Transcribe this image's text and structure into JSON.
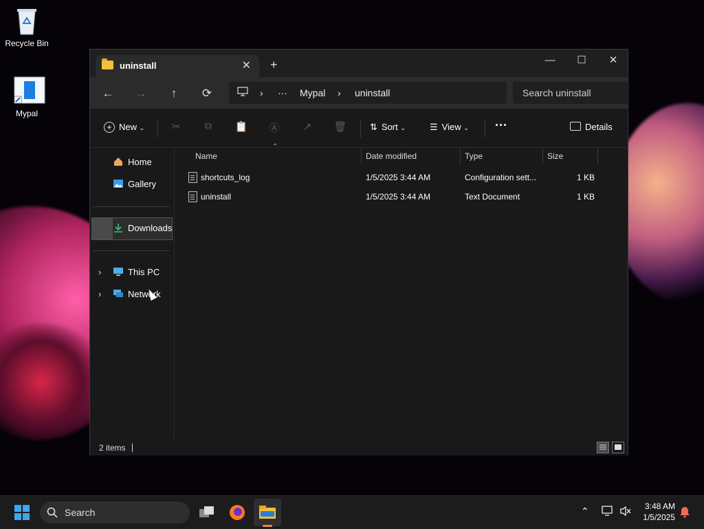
{
  "desktop": {
    "icons": [
      {
        "label": "Recycle Bin",
        "icon": "recycle-bin-icon"
      },
      {
        "label": "Mypal",
        "icon": "mypal-shortcut-icon"
      }
    ]
  },
  "window": {
    "tab_title": "uninstall",
    "tab_close": "✕",
    "new_tab": "+",
    "controls": {
      "minimize": "—",
      "maximize": "☐",
      "close": "✕"
    },
    "nav": {
      "back": "←",
      "forward": "→",
      "up": "↑",
      "refresh": "⟳"
    },
    "address": {
      "more": "···",
      "crumbs": [
        "Mypal",
        "uninstall"
      ],
      "sep": "›"
    },
    "search_placeholder": "Search uninstall",
    "commands": {
      "new": "New",
      "sort": "Sort",
      "view": "View",
      "more": "···",
      "details": "Details"
    },
    "navpane": {
      "home": "Home",
      "gallery": "Gallery",
      "downloads": "Downloads",
      "this_pc": "This PC",
      "network": "Network"
    },
    "columns": {
      "name": "Name",
      "date": "Date modified",
      "type": "Type",
      "size": "Size"
    },
    "files": [
      {
        "name": "shortcuts_log",
        "date": "1/5/2025 3:44 AM",
        "type": "Configuration sett...",
        "size": "1 KB"
      },
      {
        "name": "uninstall",
        "date": "1/5/2025 3:44 AM",
        "type": "Text Document",
        "size": "1 KB"
      }
    ],
    "status": "2 items"
  },
  "taskbar": {
    "search": "Search",
    "time": "3:48 AM",
    "date": "1/5/2025"
  },
  "colors": {
    "accent": "#0078d4",
    "folder": "#f3c03a",
    "window_bg": "#191919"
  }
}
